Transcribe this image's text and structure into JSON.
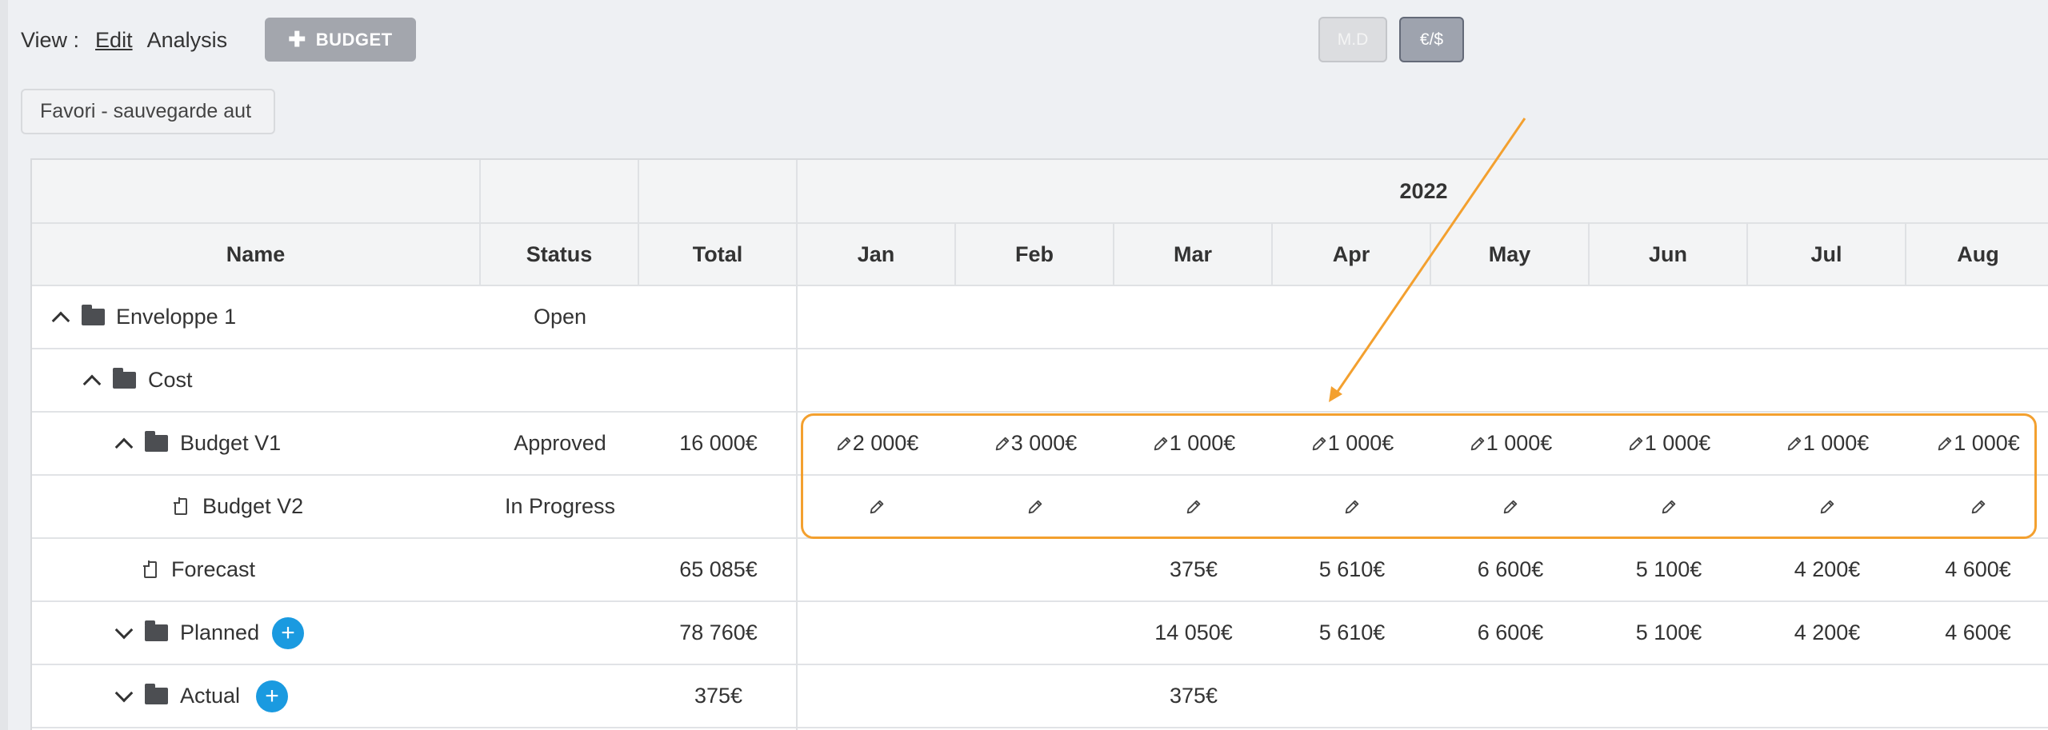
{
  "toolbar": {
    "view_label": "View :",
    "edit": "Edit",
    "analysis": "Analysis",
    "budget_button": "BUDGET",
    "toggle_md": "M.D",
    "toggle_currency": "€/$",
    "favori": "Favori - sauvegarde aut"
  },
  "table": {
    "year": "2022",
    "columns": {
      "name": "Name",
      "status": "Status",
      "total": "Total",
      "months": [
        "Jan",
        "Feb",
        "Mar",
        "Apr",
        "May",
        "Jun",
        "Jul",
        "Aug"
      ]
    },
    "rows": [
      {
        "name": "Enveloppe 1",
        "status": "Open",
        "total": "",
        "values": [
          "",
          "",
          "",
          "",
          "",
          "",
          "",
          ""
        ]
      },
      {
        "name": "Cost",
        "status": "",
        "total": "",
        "values": [
          "",
          "",
          "",
          "",
          "",
          "",
          "",
          ""
        ]
      },
      {
        "name": "Budget V1",
        "status": "Approved",
        "total": "16 000€",
        "values": [
          "2 000€",
          "3 000€",
          "1 000€",
          "1 000€",
          "1 000€",
          "1 000€",
          "1 000€",
          "1 000€"
        ]
      },
      {
        "name": "Budget V2",
        "status": "In Progress",
        "total": "",
        "values": [
          "",
          "",
          "",
          "",
          "",
          "",
          "",
          ""
        ]
      },
      {
        "name": "Forecast",
        "status": "",
        "total": "65 085€",
        "values": [
          "",
          "",
          "375€",
          "5 610€",
          "6 600€",
          "5 100€",
          "4 200€",
          "4 600€"
        ]
      },
      {
        "name": "Planned",
        "status": "",
        "total": "78 760€",
        "values": [
          "",
          "",
          "14 050€",
          "5 610€",
          "6 600€",
          "5 100€",
          "4 200€",
          "4 600€"
        ]
      },
      {
        "name": "Actual",
        "status": "",
        "total": "375€",
        "values": [
          "",
          "",
          "375€",
          "",
          "",
          "",
          "",
          ""
        ]
      }
    ]
  },
  "colors": {
    "highlight": "#f3a02f",
    "add_button": "#1a9ae0"
  }
}
